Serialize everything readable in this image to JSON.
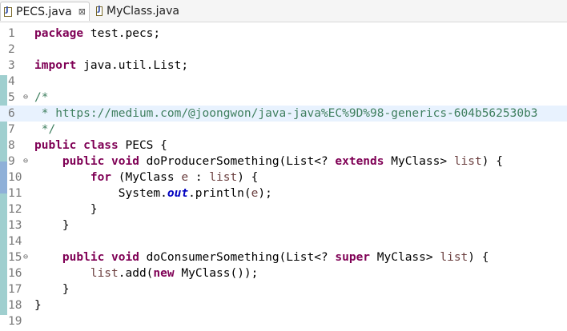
{
  "tabs": [
    {
      "label": "PECS.java",
      "active": true,
      "close": "⊠"
    },
    {
      "label": "MyClass.java",
      "active": false
    }
  ],
  "editor": {
    "lines": [
      {
        "n": "1",
        "segs": [
          [
            "kw",
            "package"
          ],
          [
            "",
            "test.pecs;"
          ]
        ]
      },
      {
        "n": "2",
        "segs": []
      },
      {
        "n": "3",
        "segs": [
          [
            "kw",
            "import"
          ],
          [
            "",
            "java.util.List;"
          ]
        ]
      },
      {
        "n": "4",
        "segs": []
      },
      {
        "n": "5",
        "fold": "⊖",
        "segs": [
          [
            "cm",
            "/*"
          ]
        ]
      },
      {
        "n": "6",
        "segs": [
          [
            "cm",
            " * https://medium.com/@joongwon/java-java%EC%9D%98-generics-604b562530b3"
          ]
        ]
      },
      {
        "n": "7",
        "segs": [
          [
            "cm",
            " */"
          ]
        ]
      },
      {
        "n": "8",
        "segs": [
          [
            "kw",
            "public class"
          ],
          [
            "",
            " PECS {"
          ]
        ]
      },
      {
        "n": "9",
        "fold": "⊖",
        "segs": [
          [
            "",
            "    "
          ],
          [
            "kw",
            "public void"
          ],
          [
            "",
            " doProducerSomething(List<? "
          ],
          [
            "kw",
            "extends"
          ],
          [
            "",
            " MyClass> "
          ],
          [
            "var",
            "list"
          ],
          [
            "",
            ") {"
          ]
        ]
      },
      {
        "n": "10",
        "segs": [
          [
            "",
            "        "
          ],
          [
            "kw",
            "for"
          ],
          [
            "",
            " (MyClass "
          ],
          [
            "var",
            "e"
          ],
          [
            "",
            " : "
          ],
          [
            "var",
            "list"
          ],
          [
            "",
            ") {"
          ]
        ]
      },
      {
        "n": "11",
        "segs": [
          [
            "",
            "            System."
          ],
          [
            "fld",
            "out"
          ],
          [
            "",
            ".println("
          ],
          [
            "var",
            "e"
          ],
          [
            "",
            ");"
          ]
        ]
      },
      {
        "n": "12",
        "segs": [
          [
            "",
            "        }"
          ]
        ]
      },
      {
        "n": "13",
        "segs": [
          [
            "",
            "    }"
          ]
        ]
      },
      {
        "n": "14",
        "segs": []
      },
      {
        "n": "15",
        "fold": "⊖",
        "segs": [
          [
            "",
            "    "
          ],
          [
            "kw",
            "public void"
          ],
          [
            "",
            " doConsumerSomething(List<? "
          ],
          [
            "kw",
            "super"
          ],
          [
            "",
            " MyClass> "
          ],
          [
            "var",
            "list"
          ],
          [
            "",
            ") {"
          ]
        ]
      },
      {
        "n": "16",
        "segs": [
          [
            "",
            "        "
          ],
          [
            "var",
            "list"
          ],
          [
            "",
            ".add("
          ],
          [
            "kw",
            "new"
          ],
          [
            "",
            " MyClass());"
          ]
        ]
      },
      {
        "n": "17",
        "segs": [
          [
            "",
            "    }"
          ]
        ]
      },
      {
        "n": "18",
        "segs": [
          [
            "",
            "}"
          ]
        ]
      },
      {
        "n": "19",
        "segs": []
      }
    ]
  }
}
